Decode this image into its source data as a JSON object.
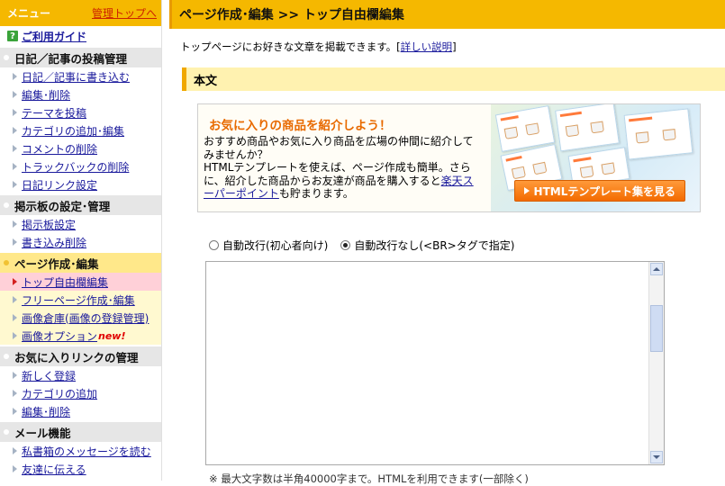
{
  "sidebar": {
    "menu_title": "メニュー",
    "admin_top": "管理トップへ",
    "guide": "ご利用ガイド",
    "sections": [
      {
        "title": "日記／記事の投稿管理",
        "items": [
          "日記／記事に書き込む",
          "編集･削除",
          "テーマを投稿",
          "カテゴリの追加･編集",
          "コメントの削除",
          "トラックバックの削除",
          "日記リンク設定"
        ]
      },
      {
        "title": "掲示板の設定･管理",
        "items": [
          "掲示板設定",
          "書き込み削除"
        ]
      },
      {
        "title": "ページ作成･編集",
        "items": [
          "トップ自由欄編集",
          "フリーページ作成･編集",
          "画像倉庫(画像の登録管理)",
          "画像オプション"
        ],
        "new_badge": "new!"
      },
      {
        "title": "お気に入りリンクの管理",
        "items": [
          "新しく登録",
          "カテゴリの追加",
          "編集･削除"
        ]
      },
      {
        "title": "メール機能",
        "items": [
          "私書箱のメッセージを読む",
          "友達に伝える"
        ]
      }
    ]
  },
  "main": {
    "page_title": "ページ作成･編集 >> トップ自由欄編集",
    "intro_text": "トップページにお好きな文章を掲載できます。[",
    "intro_link": "詳しい説明",
    "intro_close": "]",
    "section_title": "本文",
    "promo": {
      "title": "お気に入りの商品を紹介しよう！",
      "line1": "おすすめ商品やお気に入り商品を広場の仲間に紹介してみませんか？",
      "line2": "HTMLテンプレートを使えば、ページ作成も簡単。さらに、紹介した商品からお友達が商品を購入すると",
      "link": "楽天スーパーポイント",
      "line3": "も貯まります。",
      "button": "HTMLテンプレート集を見る"
    },
    "radio_auto": "自動改行(初心者向け)",
    "radio_manual": "自動改行なし(<BR>タグで指定)",
    "editor_value": "",
    "bottom_note": "※ 最大文字数は半角40000字まで。HTMLを利用できます(一部除く)"
  },
  "colors": {
    "header_orange": "#f5b800",
    "link_blue": "#1a1a9c",
    "button_orange": "#f36b00"
  }
}
